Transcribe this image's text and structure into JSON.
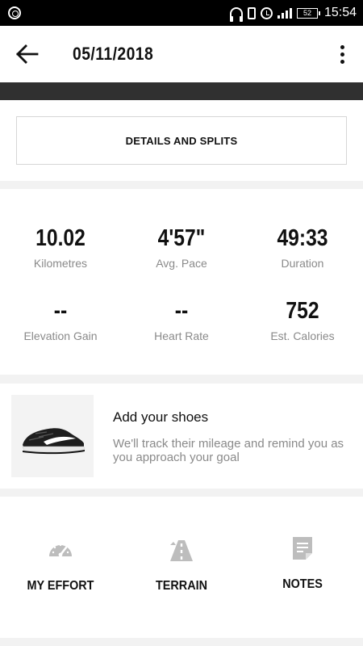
{
  "status_bar": {
    "battery": "52",
    "time": "15:54",
    "icons": [
      "app-icon",
      "headphones-icon",
      "vibrate-icon",
      "alarm-icon",
      "signal-icon",
      "battery-icon"
    ]
  },
  "header": {
    "title": "05/11/2018",
    "back_icon": "arrow-left-icon",
    "menu_icon": "more-vertical-icon"
  },
  "details": {
    "button_label": "DETAILS AND SPLITS"
  },
  "stats": [
    {
      "value": "10.02",
      "label": "Kilometres"
    },
    {
      "value": "4'57\"",
      "label": "Avg. Pace"
    },
    {
      "value": "49:33",
      "label": "Duration"
    },
    {
      "value": "--",
      "label": "Elevation Gain"
    },
    {
      "value": "--",
      "label": "Heart Rate"
    },
    {
      "value": "752",
      "label": "Est. Calories"
    }
  ],
  "shoes": {
    "title": "Add your shoes",
    "description": "We'll track their mileage and remind you as you approach your goal"
  },
  "actions": [
    {
      "label": "MY EFFORT",
      "icon": "speedometer-icon"
    },
    {
      "label": "TERRAIN",
      "icon": "road-icon"
    },
    {
      "label": "NOTES",
      "icon": "note-icon"
    }
  ],
  "colors": {
    "status_bar": "#000000",
    "band": "#303030",
    "label_gray": "#8a8a8a",
    "icon_gray": "#bdbdbd"
  }
}
